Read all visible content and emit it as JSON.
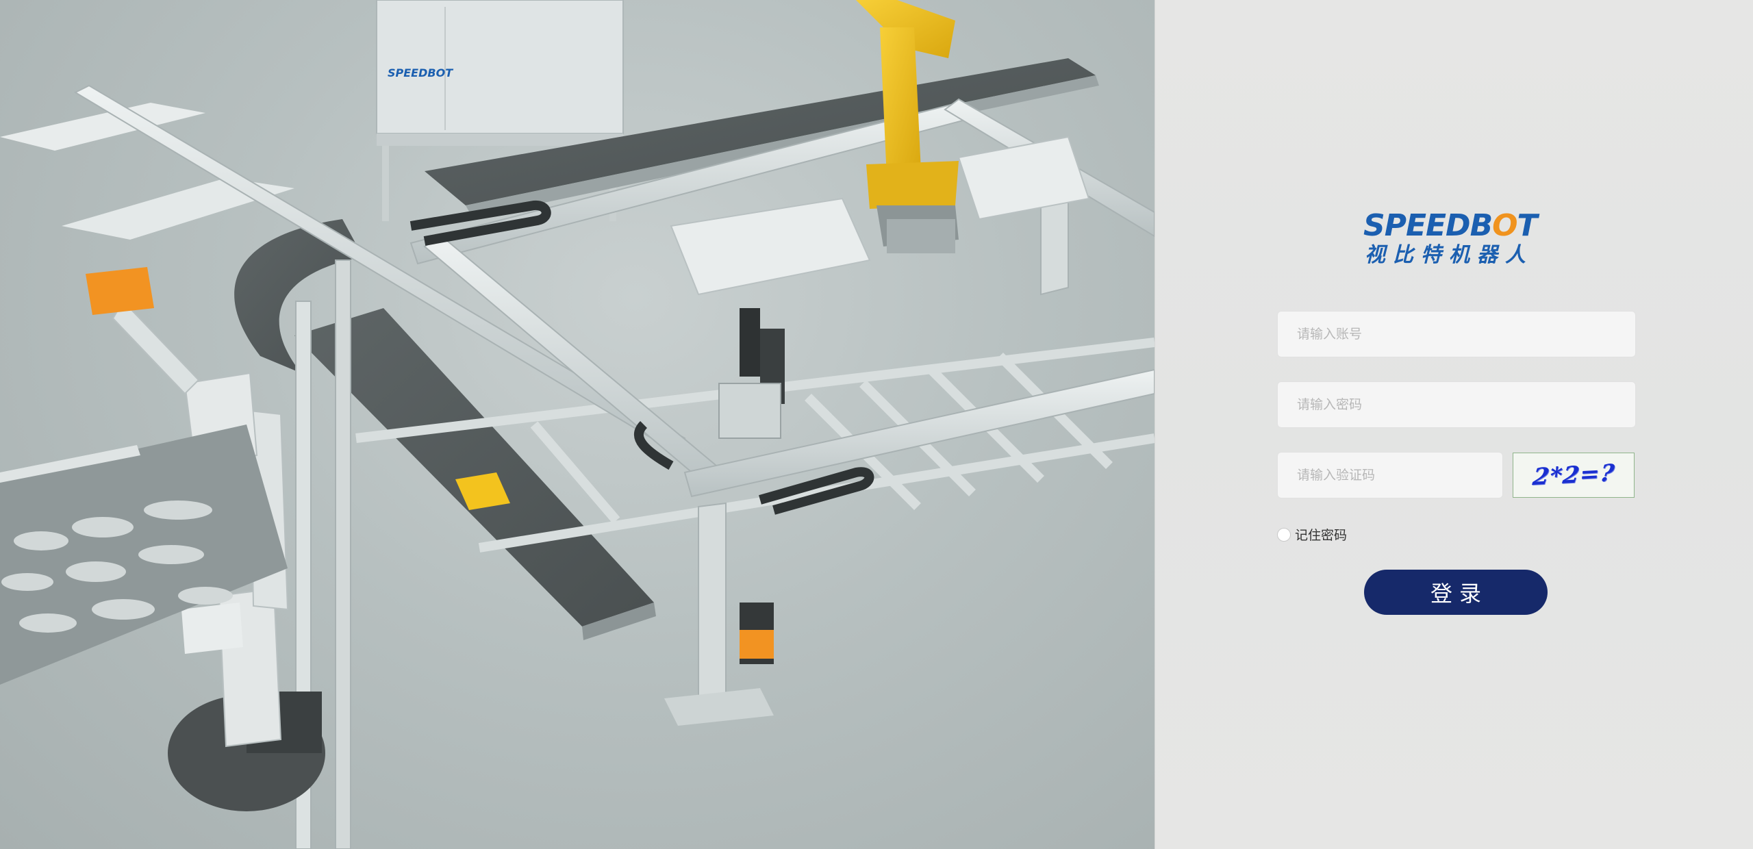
{
  "hero": {
    "cabinet_logo": "SPEEDBOT"
  },
  "brand": {
    "name_part1": "SPEEDB",
    "name_accent": "O",
    "name_part2": "T",
    "name_cn": "视比特机器人",
    "primary_color": "#1b5fb0",
    "accent_color": "#f0931e"
  },
  "login": {
    "account_placeholder": "请输入账号",
    "password_placeholder": "请输入密码",
    "captcha_placeholder": "请输入验证码",
    "captcha_text": "2*2=?",
    "remember_label": "记住密码",
    "submit_label": "登录",
    "button_color": "#16296a"
  }
}
